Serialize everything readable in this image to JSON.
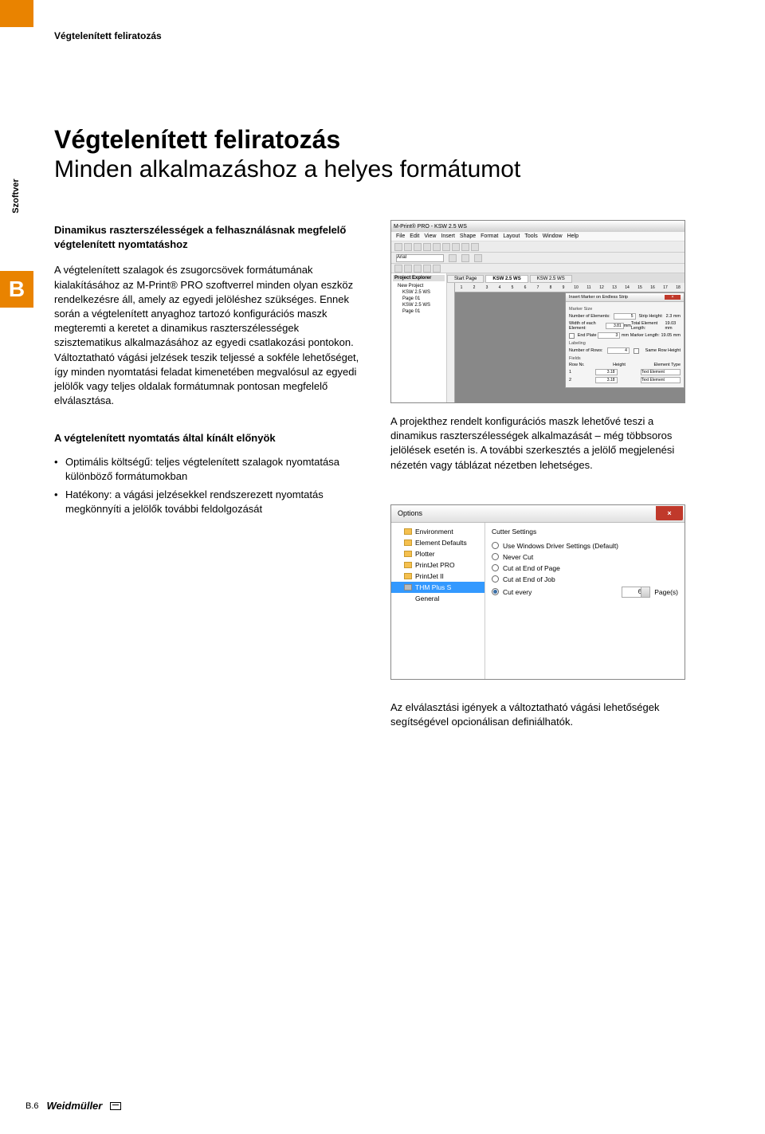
{
  "page": {
    "running_header": "Végtelenített feliratozás",
    "sidebar_label": "Szoftver",
    "section_letter": "B",
    "title_main": "Végtelenített feliratozás",
    "title_sub": "Minden alkalmazáshoz a helyes formátumot",
    "footer_page": "B.6",
    "footer_brand": "Weidmüller"
  },
  "left": {
    "h1": "Dinamikus raszterszélességek a felhasználásnak megfelelő végtelenített nyomtatáshoz",
    "p1": "A végtelenített szalagok és zsugorcsövek formátumának kialakításához az M-Print® PRO szoftverrel minden olyan eszköz rendelkezésre áll, amely az egyedi jelöléshez szükséges. Ennek során a végtelenített anyaghoz tartozó konfigurációs maszk megteremti a keretet a dinamikus raszterszélességek szisztematikus alkalmazásához az egyedi csatlakozási pontokon. Változtatható vágási jelzések teszik teljessé a sokféle lehetőséget, így minden nyomtatási feladat kimenetében megvalósul az egyedi jelölők vagy teljes oldalak formátumnak pontosan megfelelő elválasztása.",
    "h2": "A végtelenített nyomtatás által kínált előnyök",
    "bullets": [
      "Optimális költségű: teljes végtelenített szalagok nyomtatása különböző formátumokban",
      "Hatékony: a vágási jelzésekkel rendszerezett nyomtatás megkönnyíti a jelölők további feldolgozását"
    ]
  },
  "right": {
    "caption1": "A projekthez rendelt konfigurációs maszk lehetővé teszi a dinamikus raszterszélességek alkalmazását – még többsoros jelölések esetén is. A további szerkesztés a jelölő megjelenési nézetén vagy táblázat nézetben lehetséges.",
    "caption2": "Az elválasztási igények a változtatható vágási lehetőségek segítségével opcionálisan definiálhatók."
  },
  "screenshot1": {
    "window_title": "M-Print® PRO - KSW 2.5 WS",
    "menu": [
      "File",
      "Edit",
      "View",
      "Insert",
      "Shape",
      "Format",
      "Layout",
      "Tools",
      "Window",
      "Help"
    ],
    "toolbar2_font": "Arial",
    "tree_header": "Project Explorer",
    "tree": {
      "root": "New Project",
      "items": [
        "KSW 2.5 WS",
        "Page 01",
        "KSW 2.5 WS",
        "Page 01"
      ]
    },
    "tabs": [
      "Start Page",
      "KSW 2.5 WS",
      "KSW 2.5 WS"
    ],
    "ruler": [
      "1",
      "2",
      "3",
      "4",
      "5",
      "6",
      "7",
      "8",
      "9",
      "10",
      "11",
      "12",
      "13",
      "14",
      "15",
      "16",
      "17",
      "18"
    ],
    "dialog": {
      "title": "Insert Marker on Endless Strip",
      "sections": {
        "marker_size": "Marker Size",
        "labeling": "Labeling",
        "fields": "Fields"
      },
      "rows": {
        "num_elements_label": "Number of Elements:",
        "num_elements_value": "5",
        "strip_height_label": "Strip Height:",
        "strip_height_value": "2.3 mm",
        "width_each_label": "Width of each Element:",
        "width_each_value": "3.81",
        "width_each_unit": "mm",
        "total_len_label": "Total Element Length:",
        "total_len_value": "19.03 mm",
        "end_plate_label": "End Plate",
        "end_plate_value": "3",
        "end_plate_unit": "mm",
        "marker_len_label": "Marker Length:",
        "marker_len_value": "19.05 mm",
        "num_rows_label": "Number of Rows:",
        "num_rows_value": "4",
        "same_row_label": "Same Row Height",
        "row_no_header": "Row Nr.",
        "height_header": "Height",
        "element_type_header": "Element Type",
        "row1_no": "1",
        "row1_height": "3.18",
        "row1_type": "Text Element",
        "row2_no": "2",
        "row2_height": "3.18",
        "row2_type": "Text Element"
      }
    }
  },
  "screenshot2": {
    "title": "Options",
    "tree": [
      "Environment",
      "Element Defaults",
      "Plotter",
      "PrintJet PRO",
      "PrintJet II",
      "THM Plus S",
      "General"
    ],
    "panel_title": "Cutter Settings",
    "options": {
      "opt1": "Use Windows Driver Settings (Default)",
      "opt2": "Never Cut",
      "opt3": "Cut at End of Page",
      "opt4": "Cut at End of Job",
      "opt5": "Cut every",
      "opt5_value": "6",
      "opt5_unit": "Page(s)"
    }
  }
}
